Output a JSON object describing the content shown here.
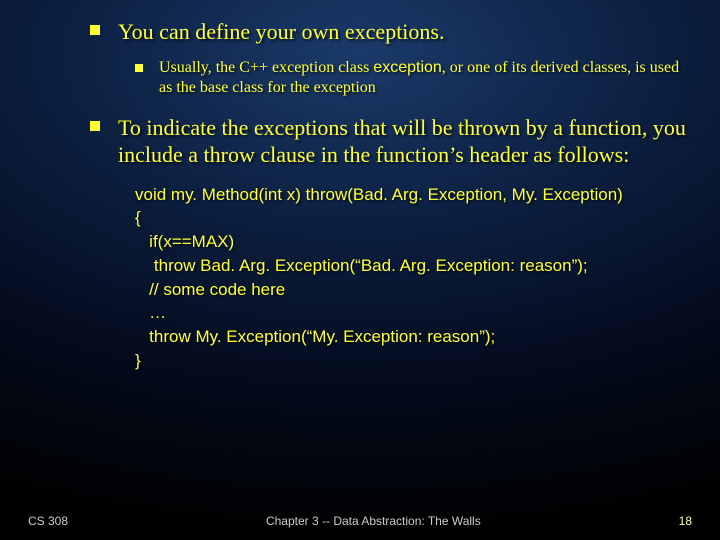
{
  "bullets": {
    "b1": "You can define your own exceptions.",
    "b1a_pre": "Usually, the C++ exception class ",
    "b1a_code": "exception",
    "b1a_post": ", or one of its derived classes, is used as the base class for the exception",
    "b2": "To indicate the exceptions that will be thrown by a function, you include a throw clause in the function’s header as follows:"
  },
  "code": {
    "l1": "void my. Method(int x) throw(Bad. Arg. Exception, My. Exception)",
    "l2": "{",
    "l3": "   if(x==MAX)",
    "l4": "    throw Bad. Arg. Exception(“Bad. Arg. Exception: reason”);",
    "l5": "   // some code here",
    "l6": "   …",
    "l7": "   throw My. Exception(“My. Exception: reason”);",
    "l8": "}"
  },
  "footer": {
    "left": "CS 308",
    "center": "Chapter 3 -- Data Abstraction: The Walls",
    "right": "18"
  }
}
